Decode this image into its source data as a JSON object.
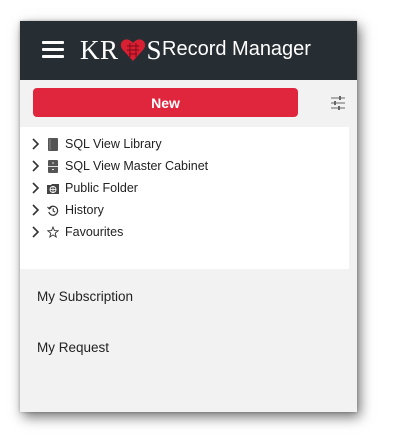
{
  "header": {
    "logo_left": "KR",
    "logo_right": "S",
    "title": "Record Manager"
  },
  "toolbar": {
    "new_label": "New"
  },
  "tree": {
    "items": [
      {
        "label": "SQL View Library",
        "icon": "book-icon"
      },
      {
        "label": "SQL View Master Cabinet",
        "icon": "cabinet-icon"
      },
      {
        "label": "Public Folder",
        "icon": "public-folder-icon"
      },
      {
        "label": "History",
        "icon": "history-icon"
      },
      {
        "label": "Favourites",
        "icon": "star-icon"
      }
    ]
  },
  "sections": {
    "subscription": "My Subscription",
    "request": "My Request"
  },
  "colors": {
    "topbar": "#262d33",
    "accent": "#e0263d",
    "panel_bg": "#f2f2f2"
  }
}
